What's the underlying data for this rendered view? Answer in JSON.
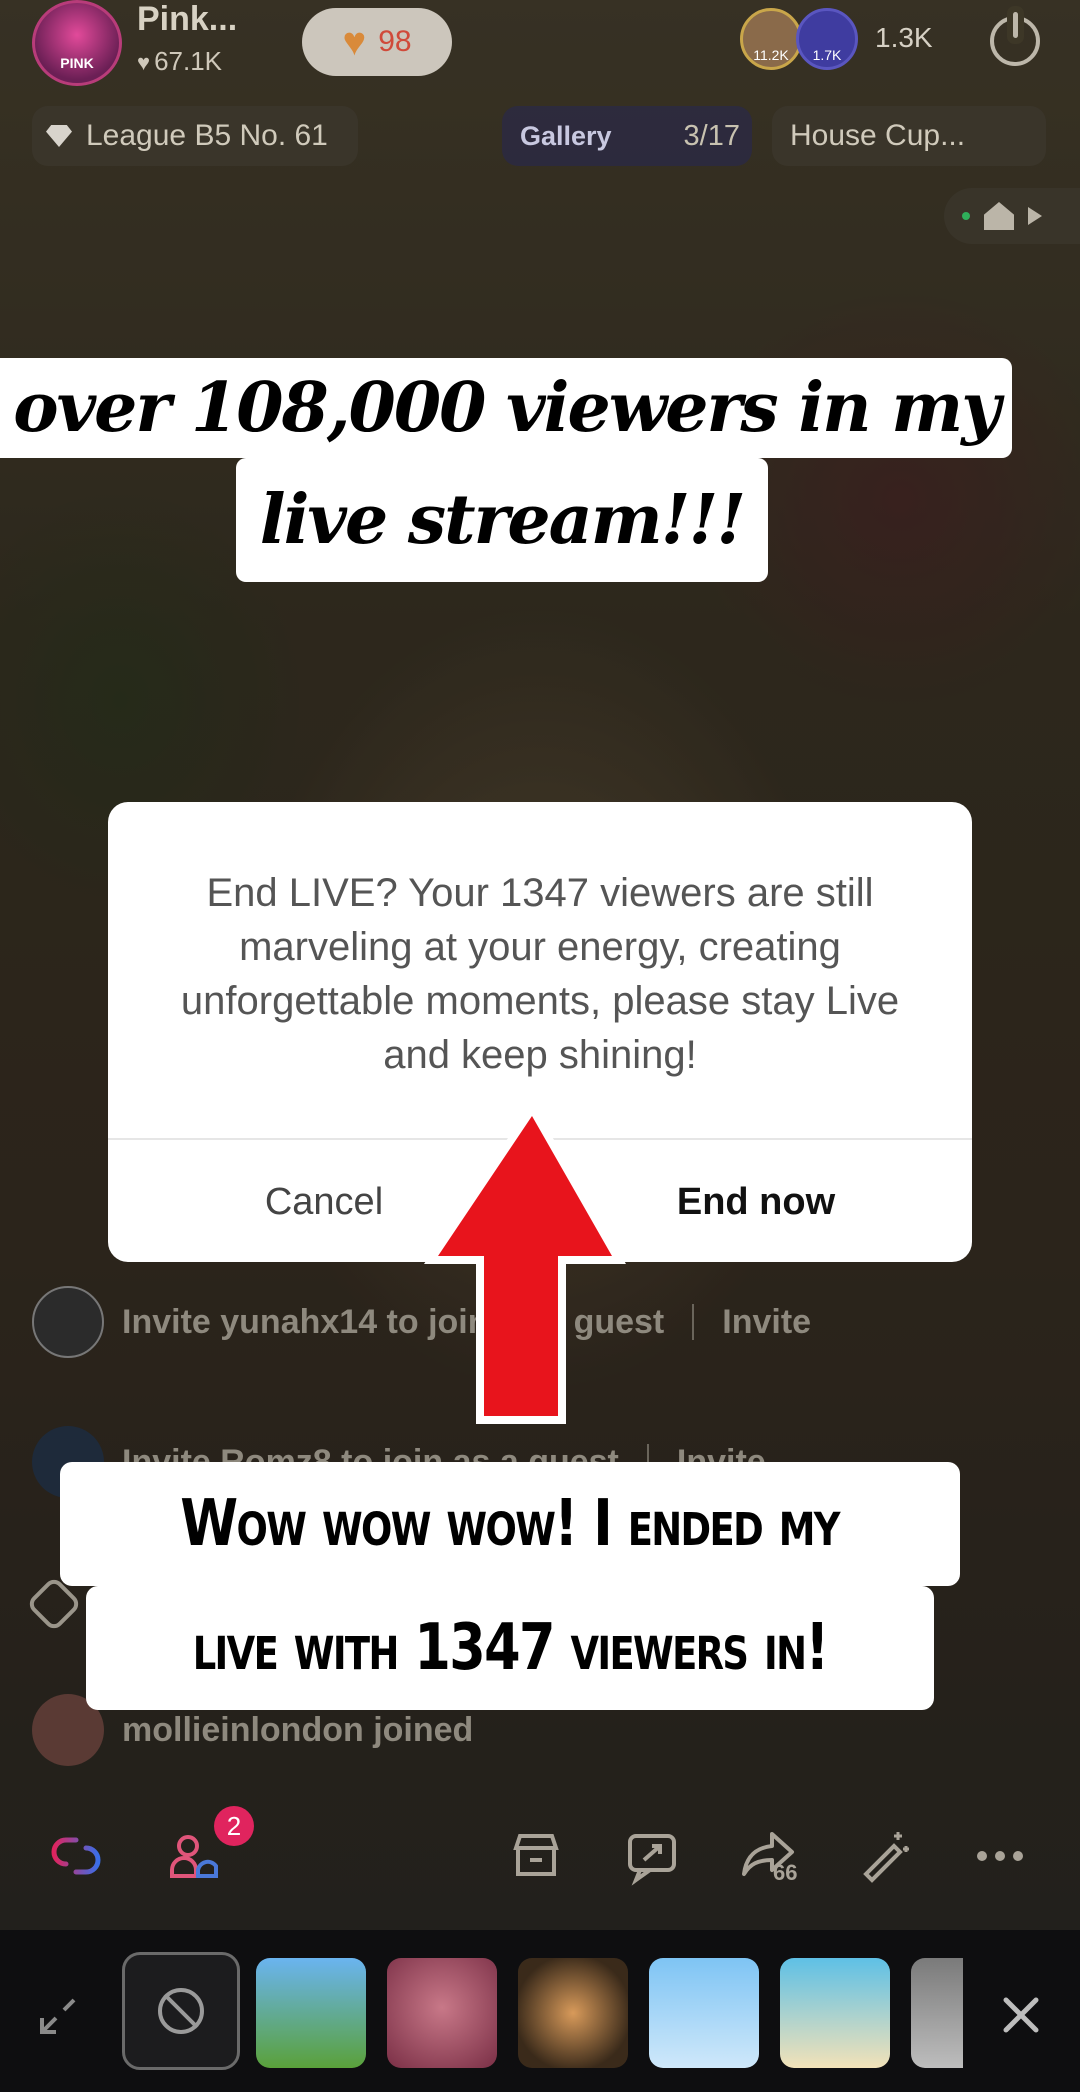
{
  "header": {
    "streamer_name": "Pink...",
    "avatar_text": "PINK",
    "likes": "67.1K",
    "gift_value": "98",
    "viewer_avatars": [
      "11.2K",
      "1.7K"
    ],
    "viewer_count": "1.3K"
  },
  "chips": {
    "league": "League B5 No. 61",
    "gallery_label": "Gallery",
    "gallery_count": "3/17",
    "house_cup": "House Cup..."
  },
  "captions": {
    "top_line1": "over 108,000 viewers in my",
    "top_line2": "live stream!!!",
    "bottom_line1": "Wow wow wow! I ended my",
    "bottom_line2": "live with 1347 viewers in!"
  },
  "dialog": {
    "message": "End LIVE? Your 1347 viewers are still marveling at your energy, creating unforgettable moments, please stay Live and keep shining!",
    "cancel_label": "Cancel",
    "end_label": "End now"
  },
  "comments": [
    {
      "text": "Invite yunahx14 to join as a guest",
      "action": "Invite"
    },
    {
      "text": "Invite Romz8 to join as a guest",
      "action": "Invite"
    },
    {
      "text": "mollieinlondon joined"
    }
  ],
  "actions": {
    "guest_badge": "2",
    "share_count": "66"
  },
  "colors": {
    "accent_red": "#e8141c",
    "badge_pink": "#e0245e"
  }
}
